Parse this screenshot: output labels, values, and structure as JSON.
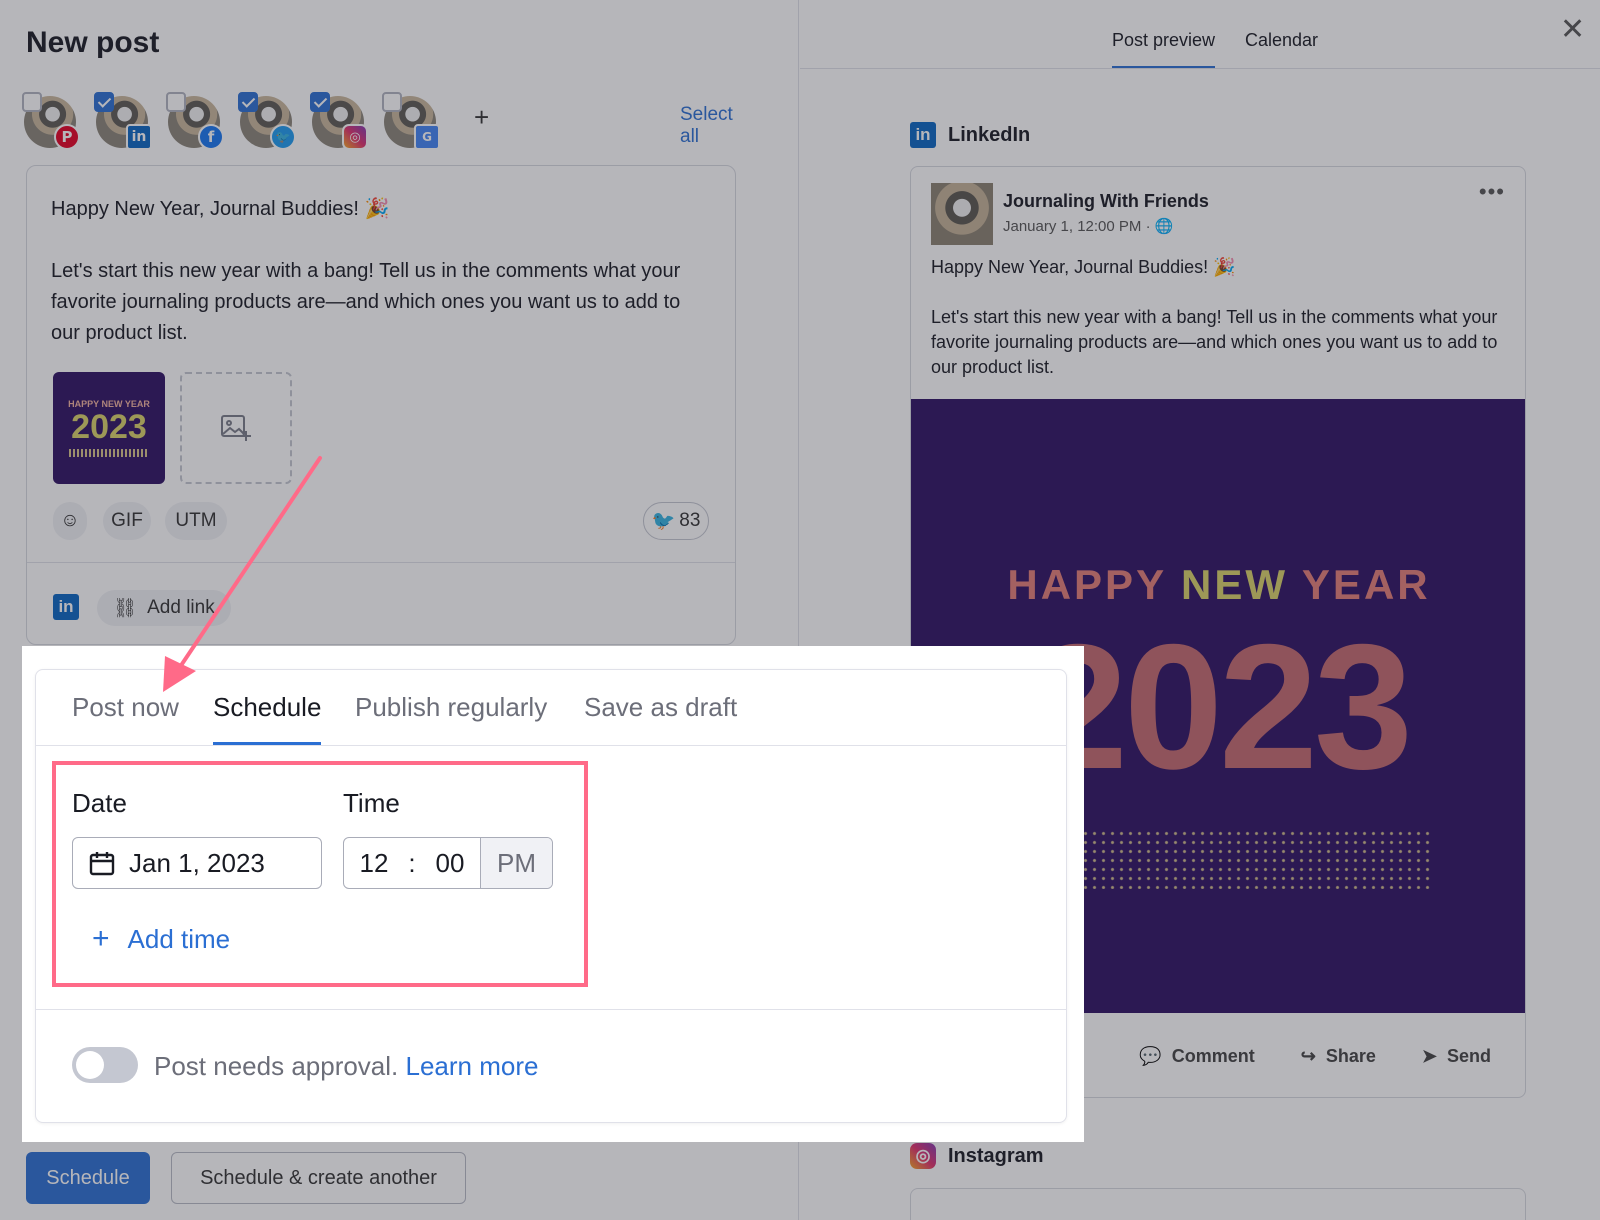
{
  "page_title": "New post",
  "accounts": [
    {
      "network": "Pinterest",
      "checked": false,
      "glyph": "P"
    },
    {
      "network": "LinkedIn",
      "checked": true,
      "glyph": "in"
    },
    {
      "network": "Facebook",
      "checked": false,
      "glyph": "f"
    },
    {
      "network": "Twitter",
      "checked": true,
      "glyph": "🐦"
    },
    {
      "network": "Instagram",
      "checked": true,
      "glyph": "◎"
    },
    {
      "network": "Google Business",
      "checked": false,
      "glyph": "G"
    }
  ],
  "add_account_glyph": "+",
  "select_all": "Select all",
  "editor": {
    "text": "Happy New Year, Journal Buddies! 🎉\n\nLet's start this new year with a bang! Tell us in the comments what your favorite journaling products are—and which ones you want us to add to our product list.",
    "thumb_top": "HAPPY NEW YEAR",
    "thumb_year": "2023",
    "gif": "GIF",
    "utm": "UTM",
    "char_count": "83",
    "linkedin_glyph": "in",
    "add_link": "Add link"
  },
  "buttons": {
    "schedule": "Schedule",
    "schedule_another": "Schedule & create another"
  },
  "right_panel": {
    "tabs": [
      "Post preview",
      "Calendar"
    ],
    "close_glyph": "✕",
    "linkedin_heading": "LinkedIn",
    "linkedin_glyph": "in",
    "author": "Journaling With Friends",
    "post_date": "January 1, 12:00 PM · 🌐",
    "more_glyph": "•••",
    "post_text": "Happy New Year, Journal Buddies! 🎉\n\nLet's start this new year with a bang! Tell us in the comments what your favorite journaling products are—and which ones you want us to add to our product list.",
    "image_line1_a": "HAPPY ",
    "image_line1_b": "NEW",
    "image_line1_c": " YEAR",
    "image_year": "2023",
    "actions": [
      "Comment",
      "Share",
      "Send"
    ],
    "instagram_heading": "Instagram",
    "instagram_glyph": "◎"
  },
  "popup": {
    "tabs": [
      "Post now",
      "Schedule",
      "Publish regularly",
      "Save as draft"
    ],
    "active_tab": "Schedule",
    "date_label": "Date",
    "date_value": "Jan 1, 2023",
    "time_label": "Time",
    "time_hour": "12",
    "time_sep": ":",
    "time_minute": "00",
    "time_ampm": "PM",
    "add_time": "Add time",
    "add_time_glyph": "+",
    "approval_text": "Post needs approval. ",
    "learn_more": "Learn more",
    "approval_enabled": false
  },
  "colors": {
    "accent": "#2b6fd3",
    "highlight": "#ff6a88",
    "image_bg": "#2e1163"
  }
}
